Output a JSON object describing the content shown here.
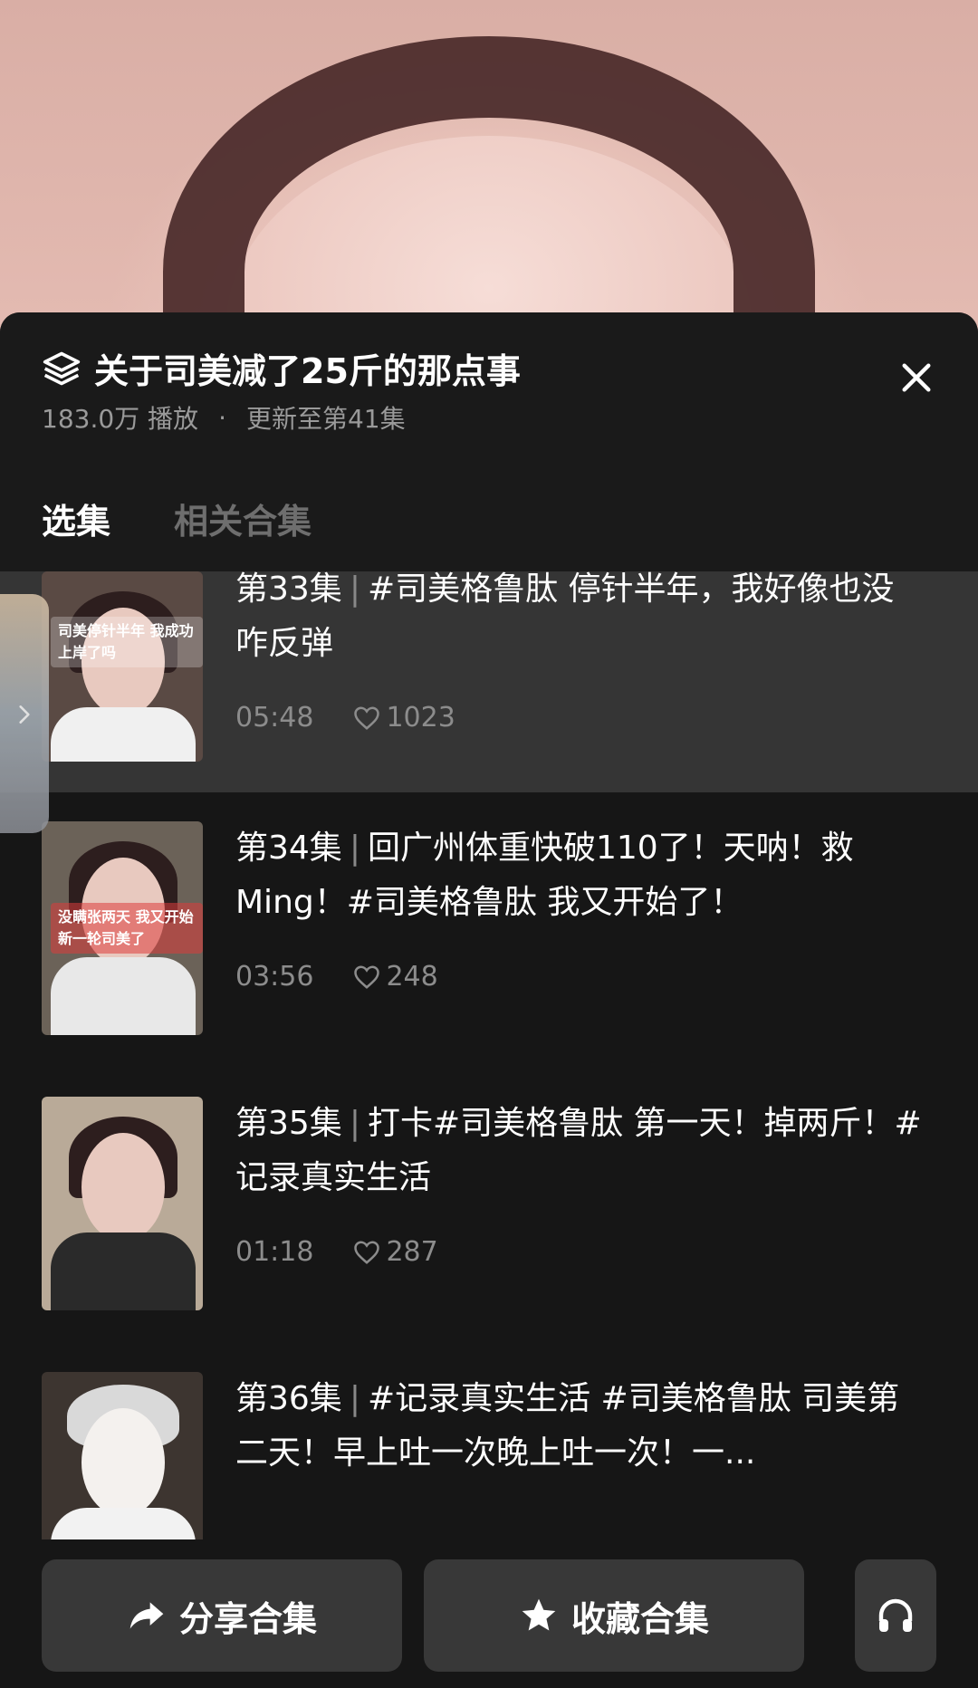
{
  "collection": {
    "title": "关于司美减了25斤的那点事",
    "plays": "183.0万 播放",
    "separator": "·",
    "update": "更新至第41集"
  },
  "tabs": [
    {
      "label": "选集",
      "active": true
    },
    {
      "label": "相关合集",
      "active": false
    }
  ],
  "episodes": [
    {
      "ep": "第33集",
      "title": "#司美格鲁肽 停针半年，我好像也没咋反弹",
      "duration": "05:48",
      "likes": "1023",
      "thumb_caption": "司美停针半年 我成功上岸了吗",
      "current": true
    },
    {
      "ep": "第34集",
      "title": "回广州体重快破110了！天呐！救Ming！#司美格鲁肽 我又开始了！",
      "duration": "03:56",
      "likes": "248",
      "thumb_caption": "没瞒张两天 我又开始新一轮司美了"
    },
    {
      "ep": "第35集",
      "title": "打卡#司美格鲁肽 第一天！掉两斤！#记录真实生活",
      "duration": "01:18",
      "likes": "287"
    },
    {
      "ep": "第36集",
      "title": "#记录真实生活 #司美格鲁肽 司美第二天！早上吐一次晚上吐一次！一...",
      "duration": "",
      "likes": ""
    }
  ],
  "actions": {
    "share": "分享合集",
    "favorite": "收藏合集"
  },
  "colors": {
    "accent": "#f7c745",
    "panel": "#161616",
    "button": "#383838"
  }
}
